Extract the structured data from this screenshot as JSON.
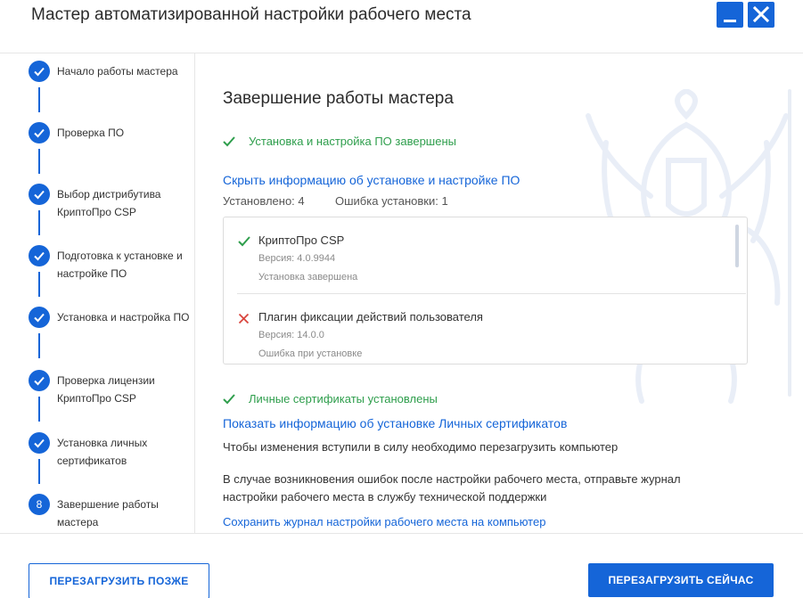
{
  "window": {
    "title": "Мастер автоматизированной настройки рабочего места"
  },
  "sidebar": {
    "steps": [
      {
        "label": "Начало работы мастера",
        "state": "done"
      },
      {
        "label": "Проверка ПО",
        "state": "done"
      },
      {
        "label": "Выбор дистрибутива КриптоПро CSP",
        "state": "done"
      },
      {
        "label": "Подготовка к установке и настройке ПО",
        "state": "done"
      },
      {
        "label": "Установка и настройка ПО",
        "state": "done"
      },
      {
        "label": "Проверка лицензии КриптоПро CSP",
        "state": "done"
      },
      {
        "label": "Установка личных сертификатов",
        "state": "done"
      },
      {
        "label": "Завершение работы мастера",
        "state": "current",
        "number": "8"
      }
    ]
  },
  "main": {
    "heading": "Завершение работы мастера",
    "software_status": "Установка и настройка ПО завершены",
    "hide_info_link": "Скрыть информацию об установке и настройке ПО",
    "installed_count": "Установлено: 4",
    "error_count": "Ошибка установки: 1",
    "items": [
      {
        "name": "КриптоПро CSP",
        "version": "Версия: 4.0.9944",
        "status": "Установка завершена",
        "result": "success"
      },
      {
        "name": "Плагин фиксации действий пользователя",
        "version": "Версия: 14.0.0",
        "status": "Ошибка при установке",
        "result": "error"
      }
    ],
    "certs_status": "Личные сертификаты установлены",
    "show_certs_link": "Показать информацию об установке Личных сертификатов",
    "restart_note": "Чтобы изменения вступили в силу необходимо перезагрузить компьютер",
    "error_note": "В случае возникновения ошибок после настройки рабочего места, отправьте журнал настройки рабочего места в службу технической поддержки",
    "save_log_link": "Сохранить журнал настройки рабочего места на компьютер"
  },
  "footer": {
    "restart_later": "ПЕРЕЗАГРУЗИТЬ ПОЗЖЕ",
    "restart_now": "ПЕРЕЗАГРУЗИТЬ СЕЙЧАС"
  },
  "colors": {
    "accent": "#1565d8",
    "success": "#2e9e4c",
    "error": "#d9453d"
  },
  "icons": {
    "step_done": "check-icon",
    "success": "check-icon",
    "error": "cross-icon",
    "minimize": "minimize-icon",
    "close": "close-icon",
    "background": "emblem-watermark"
  }
}
